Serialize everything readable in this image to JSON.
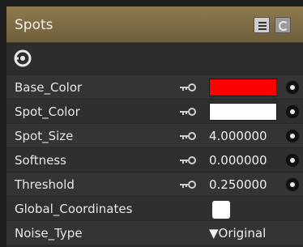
{
  "panel": {
    "title": "Spots",
    "header_icons": [
      "menu-icon",
      "preset-icon"
    ],
    "toolbar_icon": "target-icon"
  },
  "rows": [
    {
      "label": "Base_Color",
      "type": "color",
      "value": "#ff0000",
      "keyable": true
    },
    {
      "label": "Spot_Color",
      "type": "color",
      "value": "#ffffff",
      "keyable": true
    },
    {
      "label": "Spot_Size",
      "type": "number",
      "value": "4.000000",
      "keyable": true
    },
    {
      "label": "Softness",
      "type": "number",
      "value": "0.000000",
      "keyable": true
    },
    {
      "label": "Threshold",
      "type": "number",
      "value": "0.250000",
      "keyable": true
    },
    {
      "label": "Global_Coordinates",
      "type": "checkbox",
      "checked": false
    },
    {
      "label": "Noise_Type",
      "type": "dropdown",
      "value": "▼Original"
    }
  ],
  "colors": {
    "header": "#7e6c45",
    "panel": "#2b2b2b",
    "text": "#e7e7e7"
  }
}
